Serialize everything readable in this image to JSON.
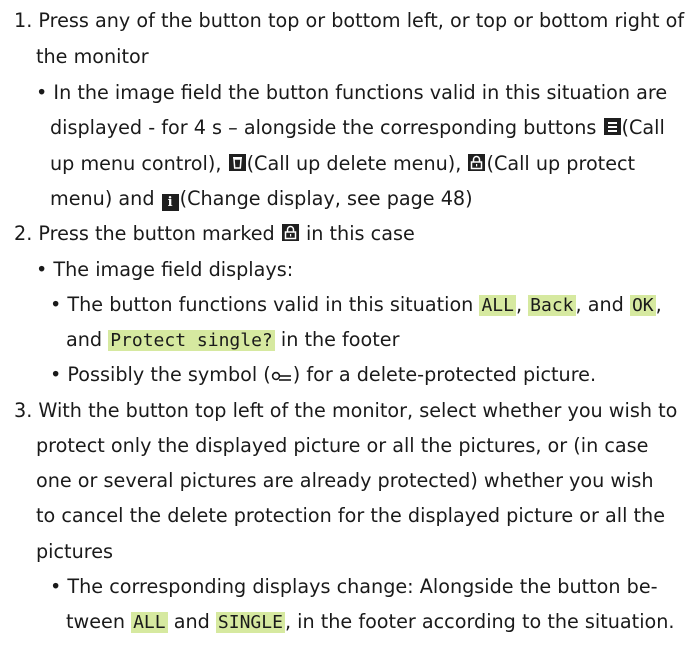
{
  "step1": {
    "l1": "1. Press any of the button top or bottom left, or top or bottom right of",
    "l2": "the monitor",
    "b1": "• In the image field the button functions valid in this situation are",
    "b2a": "displayed - for 4 s – alongside the corresponding buttons ",
    "b2b": "(Call",
    "b3a": "up menu control), ",
    "b3b": "(Call up delete menu), ",
    "b3c": "(Call up protect",
    "b4a": "menu) and ",
    "b4b": "(Change display, see page 48)"
  },
  "step2": {
    "l1a": "2. Press the button marked ",
    "l1b": "in this case",
    "b1": "• The image field displays:",
    "s1a": "• The button functions valid in this situation ",
    "s1b": ", ",
    "s1c": ", and ",
    "s1d": ",",
    "s2a": "and ",
    "s2b": " in the footer",
    "tag_all": "ALL",
    "tag_back": "Back",
    "tag_ok": "OK",
    "tag_protect": "Protect single?",
    "s3a": "• Possibly the symbol (",
    "s3b": ") for a delete-protected picture."
  },
  "step3": {
    "l1": "3. With the button top left of the monitor, select whether you wish to",
    "l2": "protect only the displayed picture or all the pictures, or (in case",
    "l3": "one or several pictures are already protected) whether you wish",
    "l4": "to cancel the delete protection for the displayed picture or all the",
    "l5": "pictures",
    "b1": "• The corresponding displays change: Alongside the button be-",
    "b2a": "tween ",
    "b2b": " and ",
    "b2c": ", in the footer according to the situation.",
    "tag_all": "ALL",
    "tag_single": "SINGLE"
  },
  "icons": {
    "menu": "menu-icon",
    "delete": "delete-icon",
    "protect": "protect-icon",
    "info": "info-icon",
    "key": "key-symbol"
  },
  "info_glyph": "i",
  "colors": {
    "highlight": "#d6e9a0",
    "icon_bg": "#1f1f1f",
    "text": "#1a1a1a"
  }
}
